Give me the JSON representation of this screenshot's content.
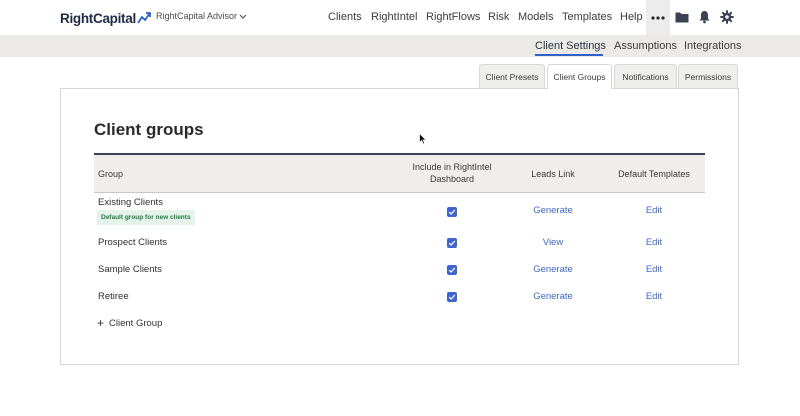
{
  "brand": {
    "name": "RightCapital"
  },
  "account": {
    "name": "RightCapital Advisor"
  },
  "nav": {
    "clients": "Clients",
    "rightintel": "RightIntel",
    "rightflows": "RightFlows",
    "risk": "Risk",
    "models": "Models",
    "templates": "Templates",
    "help": "Help"
  },
  "nav_icons": [
    "more-icon",
    "folder-icon",
    "bell-icon",
    "gear-icon"
  ],
  "subnav": {
    "client_settings": "Client Settings",
    "assumptions": "Assumptions",
    "integrations": "Integrations",
    "active": "Client Settings"
  },
  "tabs": {
    "presets": "Client Presets",
    "groups": "Client Groups",
    "notifications": "Notifications",
    "permissions": "Permissions",
    "active": "Client Groups"
  },
  "page": {
    "title": "Client groups"
  },
  "table": {
    "headers": {
      "group": "Group",
      "include": "Include in RightIntel Dashboard",
      "leads": "Leads Link",
      "templates": "Default Templates"
    },
    "rows": [
      {
        "name": "Existing Clients",
        "badge": "Default group for new clients",
        "included": true,
        "leads": "Generate",
        "templates": "Edit"
      },
      {
        "name": "Prospect Clients",
        "included": true,
        "leads": "View",
        "templates": "Edit"
      },
      {
        "name": "Sample Clients",
        "included": true,
        "leads": "Generate",
        "templates": "Edit"
      },
      {
        "name": "Retiree",
        "included": true,
        "leads": "Generate",
        "templates": "Edit"
      }
    ]
  },
  "actions": {
    "add_group": "Client Group"
  },
  "colors": {
    "accent": "#2c62c9",
    "link": "#3a68d0",
    "checkbox": "#3f63cf",
    "subnav_bg": "#ebeae6",
    "table_head_bg": "#efeeea",
    "badge_bg": "#e6f3ea",
    "badge_text": "#1f7a3f"
  }
}
